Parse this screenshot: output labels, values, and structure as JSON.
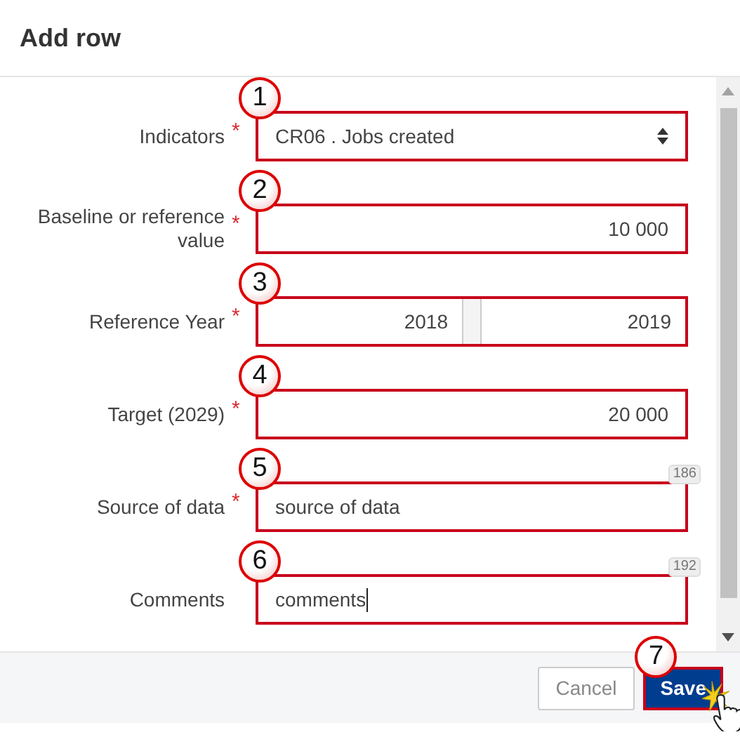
{
  "dialog": {
    "title": "Add row"
  },
  "required_marker": "*",
  "fields": [
    {
      "label": "Indicators",
      "required": true,
      "kind": "select",
      "value": "CR06 . Jobs created",
      "callout": "1"
    },
    {
      "label": "Baseline or reference value",
      "required": true,
      "kind": "number",
      "value": "10 000",
      "callout": "2"
    },
    {
      "label": "Reference Year",
      "required": true,
      "kind": "range",
      "values": [
        "2018",
        "2019"
      ],
      "callout": "3"
    },
    {
      "label": "Target (2029)",
      "required": true,
      "kind": "number",
      "value": "20 000",
      "callout": "4"
    },
    {
      "label": "Source of data",
      "required": true,
      "kind": "text",
      "value": "source of data",
      "counter": "186",
      "callout": "5",
      "focused": false
    },
    {
      "label": "Comments",
      "required": false,
      "kind": "text",
      "value": "comments",
      "counter": "192",
      "callout": "6",
      "focused": true
    }
  ],
  "buttons": [
    {
      "label": "Cancel",
      "kind": "secondary"
    },
    {
      "label": "Save",
      "kind": "primary",
      "callout": "7"
    }
  ]
}
